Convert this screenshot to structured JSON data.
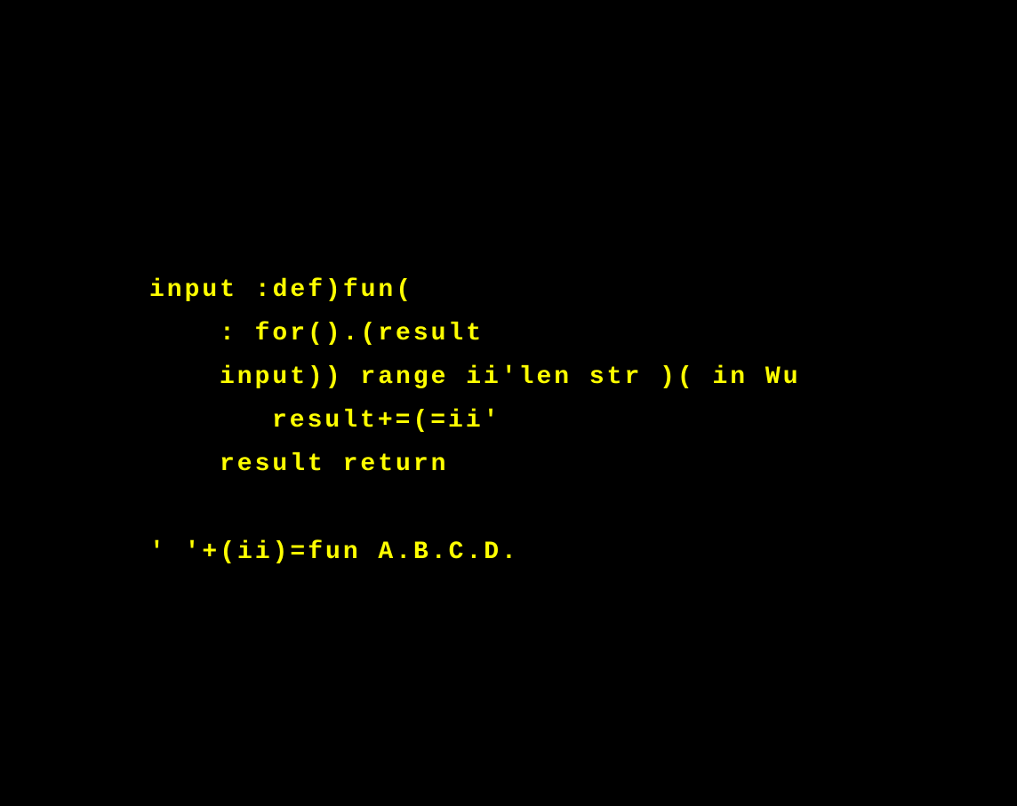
{
  "text_color": "#ffff00",
  "background_color": "#000000",
  "code_lines": [
    "input :def)fun(",
    ": for().(result",
    "input)) range ii'len str )( in Wu",
    "result+=(=ii'",
    "result return",
    "' '+(ii)=fun A.B.C.D."
  ]
}
